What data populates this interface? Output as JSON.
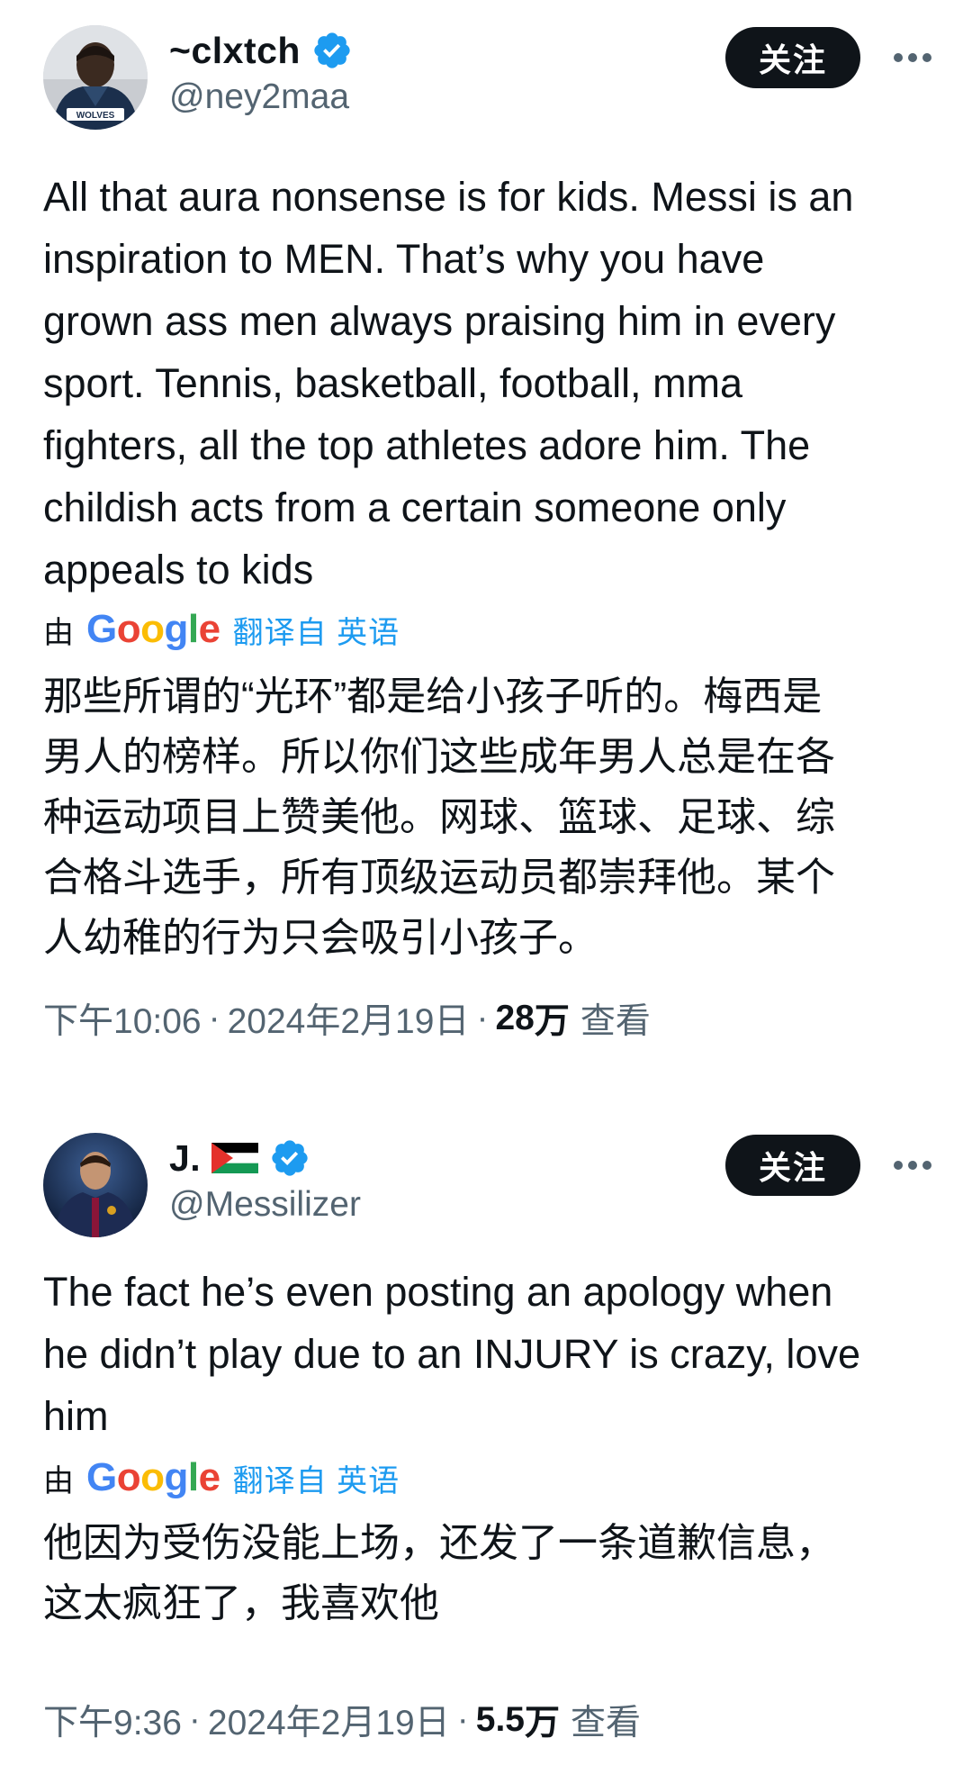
{
  "tweets": [
    {
      "author": {
        "display_name": "~clxtch",
        "handle": "@ney2maa",
        "verified": true,
        "avatar_jersey_text": "WOLVES"
      },
      "follow_label": "关注",
      "text": "All that aura nonsense is for kids. Messi is an\ninspiration to MEN. That’s why you have\ngrown ass men always praising him in every\nsport. Tennis, basketball, football, mma\nfighters, all the top athletes adore him. The\nchildish acts from a certain someone only\nappeals to kids",
      "translation": {
        "by_label": "由",
        "provider": "Google",
        "translated_from": "翻译自 英语",
        "text": "那些所谓的“光环”都是给小孩子听的。梅西是\n男人的榜样。所以你们这些成年男人总是在各\n种运动项目上赞美他。网球、篮球、足球、综\n合格斗选手，所有顶级运动员都崇拜他。某个\n人幼稚的行为只会吸引小孩子。"
      },
      "meta": {
        "time": "下午10:06",
        "date": "2024年2月19日",
        "views_count": "28",
        "views_unit": "万",
        "views_label": "查看"
      }
    },
    {
      "author": {
        "display_name": "J.",
        "handle": "@Messilizer",
        "verified": true,
        "flag": "palestine-flag"
      },
      "follow_label": "关注",
      "text": "The fact he’s even posting an apology when\nhe didn’t play due to an INJURY is crazy, love\nhim",
      "translation": {
        "by_label": "由",
        "provider": "Google",
        "translated_from": "翻译自 英语",
        "text": "他因为受伤没能上场，还发了一条道歉信息，\n这太疯狂了，我喜欢他"
      },
      "meta": {
        "time": "下午9:36",
        "date": "2024年2月19日",
        "views_count": "5.5",
        "views_unit": "万",
        "views_label": "查看"
      }
    }
  ],
  "icons": {
    "verified": "verified-badge-icon",
    "more": "more-options-icon",
    "flag": "palestine-flag-icon"
  },
  "colors": {
    "text": "#0f1419",
    "secondary": "#536471",
    "link": "#1d9bf0",
    "verified": "#1d9bf0",
    "follow_bg": "#0f1419"
  }
}
